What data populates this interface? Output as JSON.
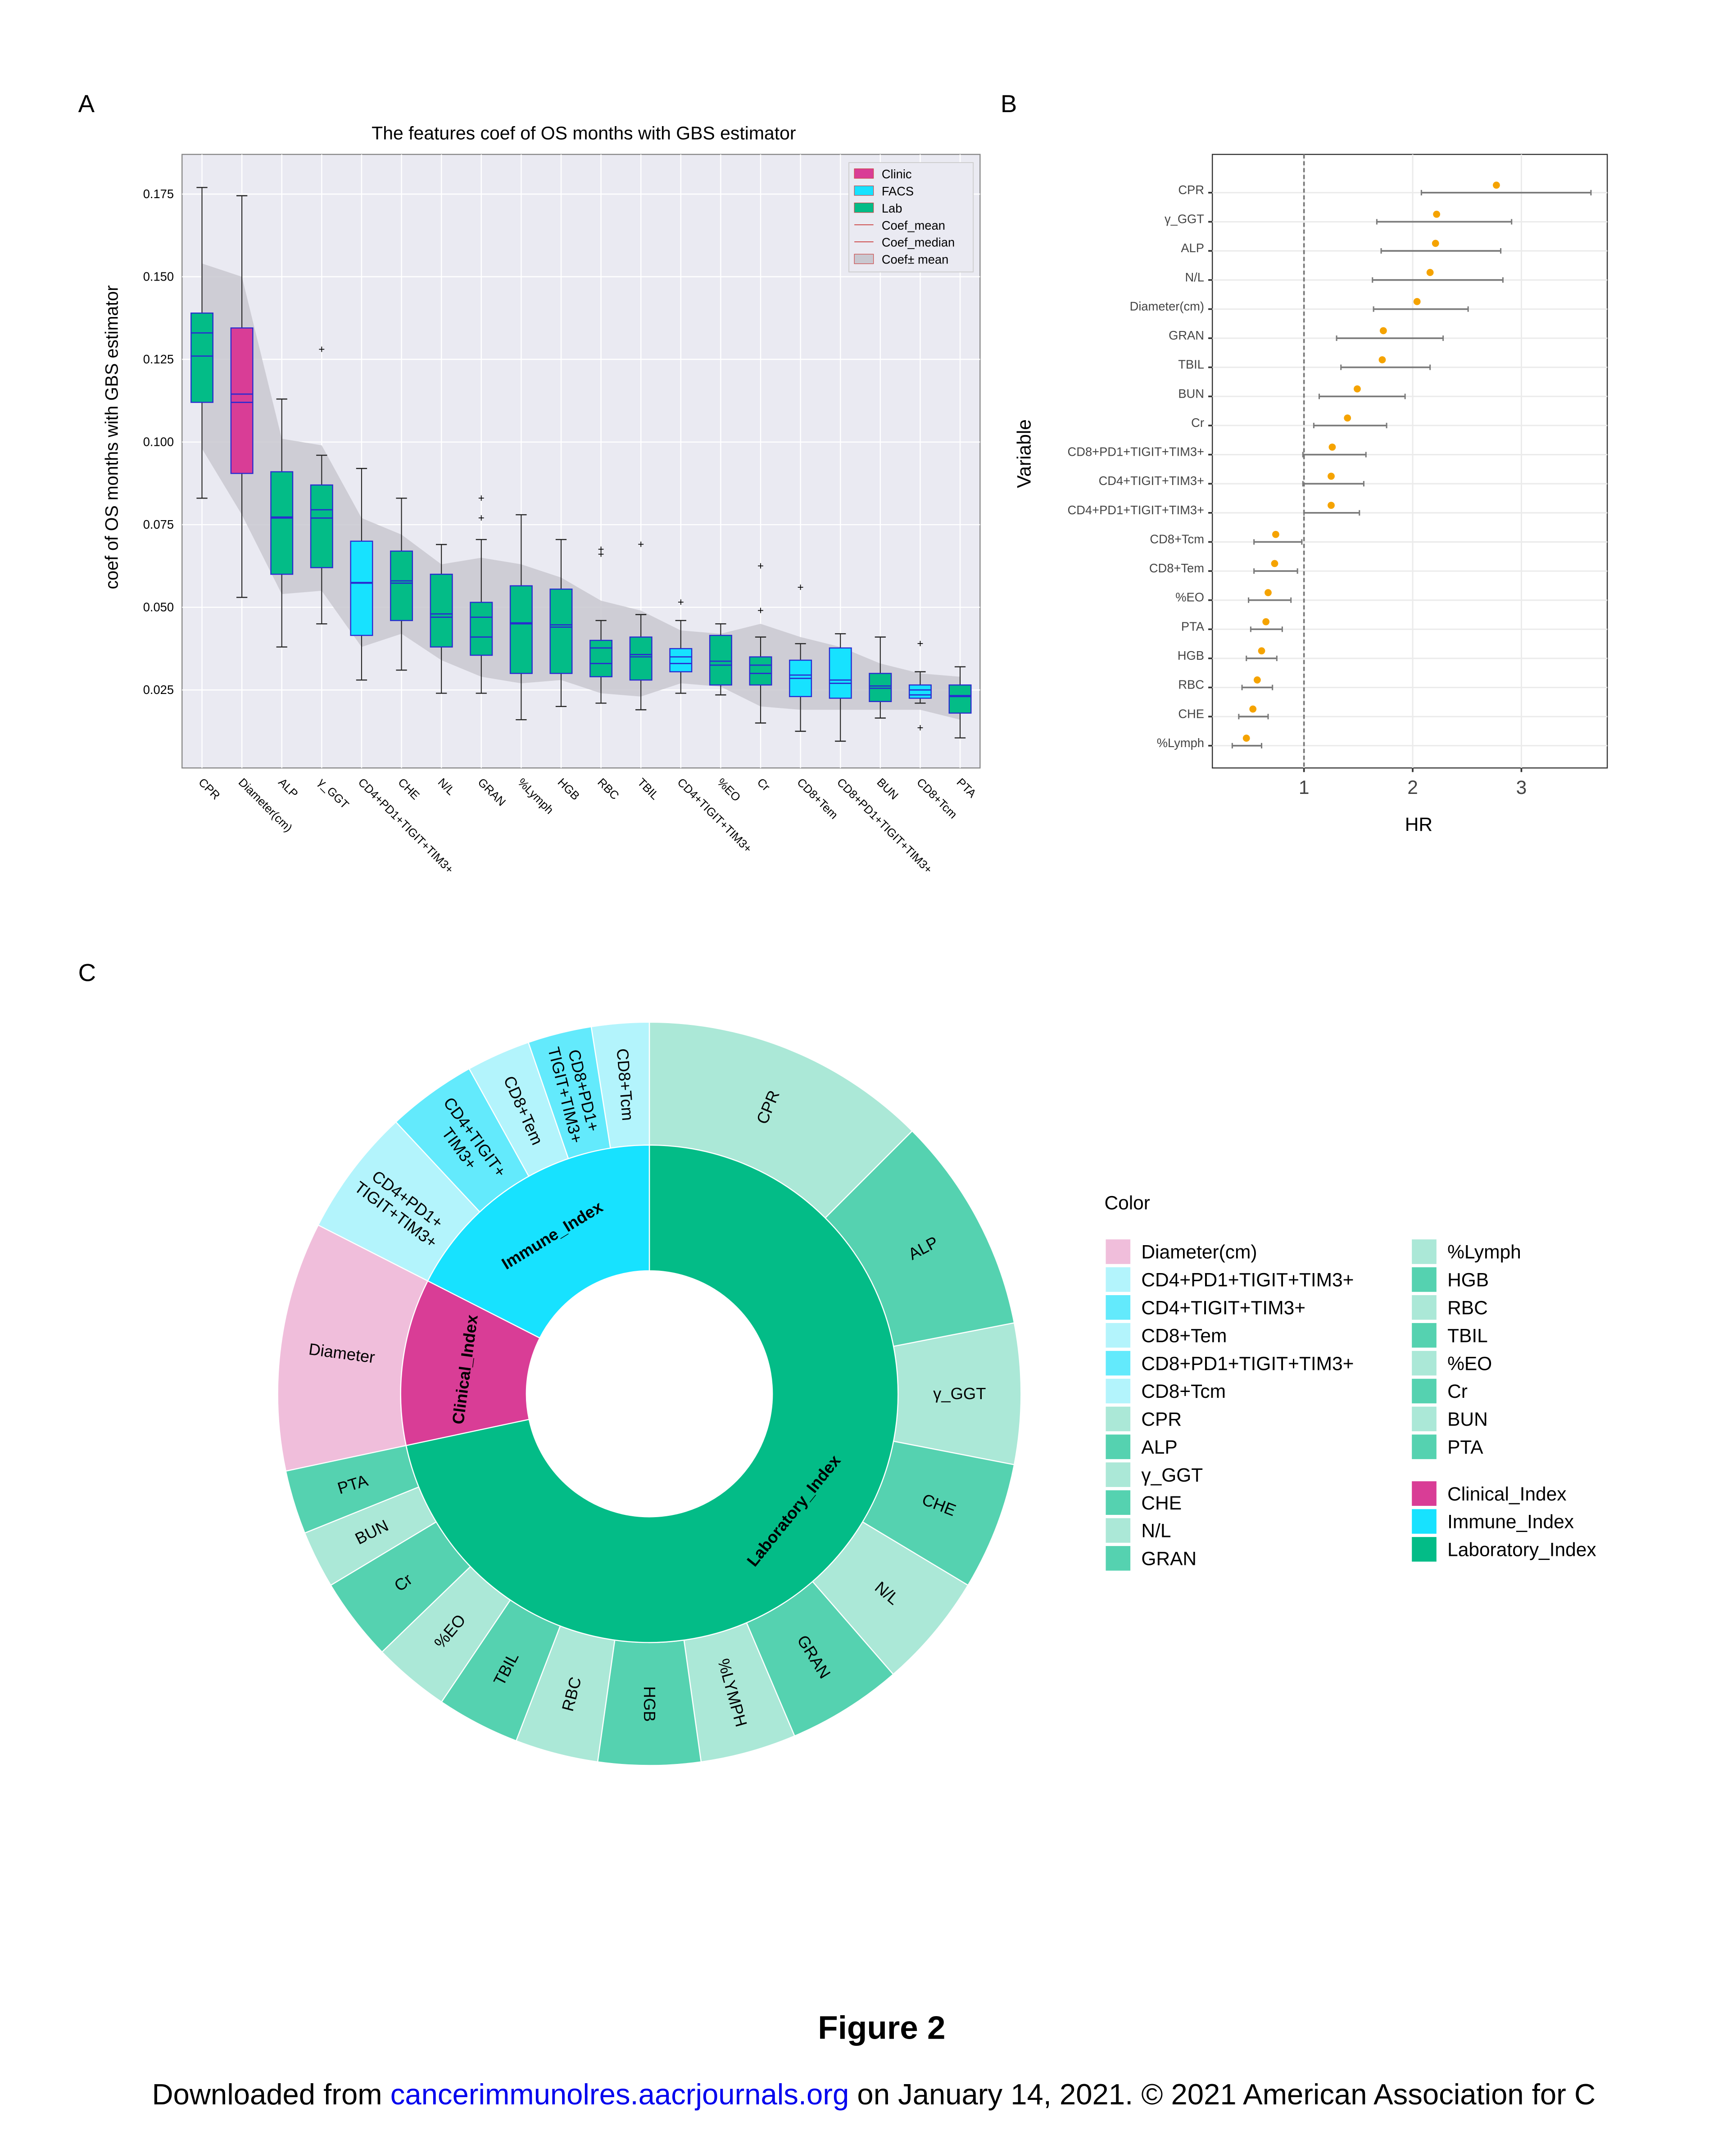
{
  "panels": {
    "a": "A",
    "b": "B",
    "c": "C"
  },
  "figure_caption": "Figure 2",
  "footer": {
    "prefix": "Downloaded from ",
    "link": "cancerimmunolres.aacrjournals.org",
    "suffix": " on January 14, 2021. © 2021 American Association for C",
    "link_color": "#0000ee"
  },
  "colors": {
    "clinic": "#d93d96",
    "facs": "#17e2ff",
    "lab": "#03bc87",
    "plot_bg": "#eaeaf2",
    "band": "#c9c8d0",
    "hr_point": "#f5a300",
    "hr_bar": "#7a7a7a"
  },
  "chart_data": [
    {
      "type": "box",
      "title": "The features coef of OS months with GBS estimator",
      "xlabel": "",
      "ylabel": "coef of OS months with GBS estimator",
      "ylim": [
        0.0014,
        0.187
      ],
      "yticks": [
        "0.025",
        "0.050",
        "0.075",
        "0.100",
        "0.125",
        "0.150",
        "0.175"
      ],
      "grid": true,
      "legend": {
        "position": "top-right",
        "entries": [
          "Clinic",
          "FACS",
          "Lab",
          "Coef_mean",
          "Coef_median",
          "Coef± mean"
        ]
      },
      "categories": [
        "CPR",
        "Diameter(cm)",
        "ALP",
        "γ_GGT",
        "CD4+PD1+TIGIT+TIM3+",
        "CHE",
        "N/L",
        "GRAN",
        "%Lymph",
        "HGB",
        "RBC",
        "TBIL",
        "CD4+TIGIT+TIM3+",
        "%EO",
        "Cr",
        "CD8+Tem",
        "CD8+PD1+TIGIT+TIM3+",
        "BUN",
        "CD8+Tcm",
        "PTA"
      ],
      "groups": [
        "Lab",
        "Clinic",
        "Lab",
        "Lab",
        "FACS",
        "Lab",
        "Lab",
        "Lab",
        "Lab",
        "Lab",
        "Lab",
        "Lab",
        "FACS",
        "Lab",
        "Lab",
        "FACS",
        "FACS",
        "Lab",
        "FACS",
        "Lab"
      ],
      "boxes": [
        {
          "min": 0.083,
          "q1": 0.112,
          "median": 0.126,
          "mean": 0.133,
          "q3": 0.139,
          "max": 0.177,
          "outliers": []
        },
        {
          "min": 0.053,
          "q1": 0.0905,
          "median": 0.112,
          "mean": 0.1145,
          "q3": 0.1345,
          "max": 0.1745,
          "outliers": []
        },
        {
          "min": 0.038,
          "q1": 0.06,
          "median": 0.077,
          "mean": 0.0773,
          "q3": 0.091,
          "max": 0.113,
          "outliers": []
        },
        {
          "min": 0.045,
          "q1": 0.062,
          "median": 0.077,
          "mean": 0.0795,
          "q3": 0.087,
          "max": 0.096,
          "outliers": [
            0.128
          ]
        },
        {
          "min": 0.028,
          "q1": 0.0415,
          "median": 0.0573,
          "mean": 0.0575,
          "q3": 0.07,
          "max": 0.092,
          "outliers": []
        },
        {
          "min": 0.031,
          "q1": 0.046,
          "median": 0.0573,
          "mean": 0.058,
          "q3": 0.067,
          "max": 0.083,
          "outliers": []
        },
        {
          "min": 0.024,
          "q1": 0.038,
          "median": 0.047,
          "mean": 0.048,
          "q3": 0.06,
          "max": 0.069,
          "outliers": []
        },
        {
          "min": 0.024,
          "q1": 0.0355,
          "median": 0.041,
          "mean": 0.047,
          "q3": 0.0515,
          "max": 0.0705,
          "outliers": [
            0.077,
            0.083
          ]
        },
        {
          "min": 0.016,
          "q1": 0.03,
          "median": 0.045,
          "mean": 0.0453,
          "q3": 0.0565,
          "max": 0.078,
          "outliers": []
        },
        {
          "min": 0.02,
          "q1": 0.03,
          "median": 0.044,
          "mean": 0.0447,
          "q3": 0.0555,
          "max": 0.0705,
          "outliers": []
        },
        {
          "min": 0.021,
          "q1": 0.029,
          "median": 0.033,
          "mean": 0.0377,
          "q3": 0.04,
          "max": 0.046,
          "outliers": [
            0.066,
            0.0675
          ]
        },
        {
          "min": 0.019,
          "q1": 0.028,
          "median": 0.035,
          "mean": 0.0357,
          "q3": 0.041,
          "max": 0.0478,
          "outliers": [
            0.069
          ]
        },
        {
          "min": 0.024,
          "q1": 0.0305,
          "median": 0.033,
          "mean": 0.035,
          "q3": 0.0375,
          "max": 0.046,
          "outliers": [
            0.0515
          ]
        },
        {
          "min": 0.0235,
          "q1": 0.0265,
          "median": 0.0325,
          "mean": 0.0337,
          "q3": 0.0415,
          "max": 0.045,
          "outliers": []
        },
        {
          "min": 0.015,
          "q1": 0.0265,
          "median": 0.03,
          "mean": 0.0325,
          "q3": 0.035,
          "max": 0.041,
          "outliers": [
            0.049,
            0.0625
          ]
        },
        {
          "min": 0.0125,
          "q1": 0.023,
          "median": 0.0285,
          "mean": 0.0295,
          "q3": 0.034,
          "max": 0.039,
          "outliers": [
            0.056
          ]
        },
        {
          "min": 0.0095,
          "q1": 0.0225,
          "median": 0.027,
          "mean": 0.028,
          "q3": 0.0377,
          "max": 0.042,
          "outliers": []
        },
        {
          "min": 0.0165,
          "q1": 0.0215,
          "median": 0.0255,
          "mean": 0.0262,
          "q3": 0.03,
          "max": 0.041,
          "outliers": []
        },
        {
          "min": 0.021,
          "q1": 0.0225,
          "median": 0.0235,
          "mean": 0.025,
          "q3": 0.0265,
          "max": 0.0305,
          "outliers": [
            0.039,
            0.0135
          ]
        },
        {
          "min": 0.0105,
          "q1": 0.018,
          "median": 0.023,
          "mean": 0.0233,
          "q3": 0.0265,
          "max": 0.032,
          "outliers": []
        }
      ],
      "band_upper": [
        0.154,
        0.15,
        0.101,
        0.099,
        0.077,
        0.072,
        0.063,
        0.065,
        0.063,
        0.059,
        0.052,
        0.049,
        0.043,
        0.042,
        0.045,
        0.041,
        0.038,
        0.033,
        0.03,
        0.029
      ],
      "band_lower": [
        0.098,
        0.078,
        0.054,
        0.055,
        0.038,
        0.042,
        0.034,
        0.029,
        0.027,
        0.028,
        0.024,
        0.023,
        0.027,
        0.026,
        0.02,
        0.019,
        0.019,
        0.019,
        0.019,
        0.016
      ]
    },
    {
      "type": "forest",
      "xlabel": "HR",
      "ylabel": "Variable",
      "xlim": [
        0.157,
        3.79
      ],
      "xticks": [
        "1",
        "2",
        "3"
      ],
      "reference_line": 1,
      "grid": true,
      "rows": [
        {
          "label": "CPR",
          "hr": 2.77,
          "lo": 2.08,
          "hi": 3.64
        },
        {
          "label": "γ_GGT",
          "hr": 2.22,
          "lo": 1.67,
          "hi": 2.91
        },
        {
          "label": "ALP",
          "hr": 2.21,
          "lo": 1.71,
          "hi": 2.81
        },
        {
          "label": "N/L",
          "hr": 2.16,
          "lo": 1.63,
          "hi": 2.83
        },
        {
          "label": "Diameter(cm)",
          "hr": 2.04,
          "lo": 1.64,
          "hi": 2.51
        },
        {
          "label": "GRAN",
          "hr": 1.73,
          "lo": 1.3,
          "hi": 2.28
        },
        {
          "label": "TBIL",
          "hr": 1.72,
          "lo": 1.34,
          "hi": 2.16
        },
        {
          "label": "BUN",
          "hr": 1.49,
          "lo": 1.14,
          "hi": 1.93
        },
        {
          "label": "Cr",
          "hr": 1.4,
          "lo": 1.09,
          "hi": 1.76
        },
        {
          "label": "CD8+PD1+TIGIT+TIM3+",
          "hr": 1.26,
          "lo": 0.99,
          "hi": 1.57
        },
        {
          "label": "CD4+TIGIT+TIM3+",
          "hr": 1.25,
          "lo": 0.99,
          "hi": 1.55
        },
        {
          "label": "CD4+PD1+TIGIT+TIM3+",
          "hr": 1.25,
          "lo": 1.0,
          "hi": 1.51
        },
        {
          "label": "CD8+Tcm",
          "hr": 0.74,
          "lo": 0.54,
          "hi": 0.98
        },
        {
          "label": "CD8+Tem",
          "hr": 0.73,
          "lo": 0.54,
          "hi": 0.94
        },
        {
          "label": "%EO",
          "hr": 0.67,
          "lo": 0.49,
          "hi": 0.88
        },
        {
          "label": "PTA",
          "hr": 0.65,
          "lo": 0.51,
          "hi": 0.8
        },
        {
          "label": "HGB",
          "hr": 0.61,
          "lo": 0.47,
          "hi": 0.75
        },
        {
          "label": "RBC",
          "hr": 0.57,
          "lo": 0.43,
          "hi": 0.71
        },
        {
          "label": "CHE",
          "hr": 0.53,
          "lo": 0.4,
          "hi": 0.67
        },
        {
          "label": "%Lymph",
          "hr": 0.47,
          "lo": 0.34,
          "hi": 0.61
        }
      ]
    },
    {
      "type": "sunburst",
      "legend_title": "Color",
      "inner": [
        {
          "label": "Laboratory_Index",
          "value": 258,
          "color": "#03bc87"
        },
        {
          "label": "Clinical_Index",
          "value": 39,
          "color": "#d93d96"
        },
        {
          "label": "Immune_Index",
          "value": 63,
          "color": "#17e2ff"
        }
      ],
      "outer": [
        {
          "label": "CPR",
          "value": 45,
          "color": "#abe8d7",
          "parent": "Laboratory_Index"
        },
        {
          "label": "ALP",
          "value": 34,
          "color": "#55d2b0",
          "parent": "Laboratory_Index"
        },
        {
          "label": "γ_GGT",
          "value": 22,
          "color": "#abe8d7",
          "parent": "Laboratory_Index"
        },
        {
          "label": "CHE",
          "value": 20,
          "color": "#55d2b0",
          "parent": "Laboratory_Index"
        },
        {
          "label": "N/L",
          "value": 18,
          "color": "#abe8d7",
          "parent": "Laboratory_Index"
        },
        {
          "label": "GRAN",
          "value": 18,
          "color": "#55d2b0",
          "parent": "Laboratory_Index"
        },
        {
          "label": "%LYMPH",
          "value": 15,
          "color": "#abe8d7",
          "parent": "Laboratory_Index"
        },
        {
          "label": "HGB",
          "value": 16,
          "color": "#55d2b0",
          "parent": "Laboratory_Index"
        },
        {
          "label": "RBC",
          "value": 13,
          "color": "#abe8d7",
          "parent": "Laboratory_Index"
        },
        {
          "label": "TBIL",
          "value": 13,
          "color": "#55d2b0",
          "parent": "Laboratory_Index"
        },
        {
          "label": "%EO",
          "value": 12,
          "color": "#abe8d7",
          "parent": "Laboratory_Index"
        },
        {
          "label": "Cr",
          "value": 13,
          "color": "#55d2b0",
          "parent": "Laboratory_Index"
        },
        {
          "label": "BUN",
          "value": 9,
          "color": "#abe8d7",
          "parent": "Laboratory_Index"
        },
        {
          "label": "PTA",
          "value": 10,
          "color": "#55d2b0",
          "parent": "Laboratory_Index"
        },
        {
          "label": "Diameter",
          "value": 39,
          "color": "#f0bedb",
          "parent": "Clinical_Index"
        },
        {
          "label": "CD4+PD1+ TIGIT+TIM3+",
          "value": 20,
          "color": "#b3f4fc",
          "parent": "Immune_Index"
        },
        {
          "label": "CD4+TIGIT+ TIM3+",
          "value": 14,
          "color": "#63eafc",
          "parent": "Immune_Index"
        },
        {
          "label": "CD8+Tem",
          "value": 10,
          "color": "#b3f4fc",
          "parent": "Immune_Index"
        },
        {
          "label": "CD8+PD1+ TIGIT+TIM3+",
          "value": 10,
          "color": "#63eafc",
          "parent": "Immune_Index"
        },
        {
          "label": "CD8+Tcm",
          "value": 9,
          "color": "#b3f4fc",
          "parent": "Immune_Index"
        }
      ],
      "legend_col1": [
        {
          "label": "Diameter(cm)",
          "color": "#f0bedb"
        },
        {
          "label": "CD4+PD1+TIGIT+TIM3+",
          "color": "#b3f4fc"
        },
        {
          "label": "CD4+TIGIT+TIM3+",
          "color": "#63eafc"
        },
        {
          "label": "CD8+Tem",
          "color": "#b3f4fc"
        },
        {
          "label": "CD8+PD1+TIGIT+TIM3+",
          "color": "#63eafc"
        },
        {
          "label": "CD8+Tcm",
          "color": "#b3f4fc"
        },
        {
          "label": "CPR",
          "color": "#abe8d7"
        },
        {
          "label": "ALP",
          "color": "#55d2b0"
        },
        {
          "label": "γ_GGT",
          "color": "#abe8d7"
        },
        {
          "label": "CHE",
          "color": "#55d2b0"
        },
        {
          "label": "N/L",
          "color": "#abe8d7"
        },
        {
          "label": "GRAN",
          "color": "#55d2b0"
        }
      ],
      "legend_col2": [
        {
          "label": "%Lymph",
          "color": "#abe8d7"
        },
        {
          "label": "HGB",
          "color": "#55d2b0"
        },
        {
          "label": "RBC",
          "color": "#abe8d7"
        },
        {
          "label": "TBIL",
          "color": "#55d2b0"
        },
        {
          "label": "%EO",
          "color": "#abe8d7"
        },
        {
          "label": "Cr",
          "color": "#55d2b0"
        },
        {
          "label": "BUN",
          "color": "#abe8d7"
        },
        {
          "label": "PTA",
          "color": "#55d2b0"
        }
      ],
      "legend_col2_index": [
        {
          "label": "Clinical_Index",
          "color": "#d93d96"
        },
        {
          "label": "Immune_Index",
          "color": "#17e2ff"
        },
        {
          "label": "Laboratory_Index",
          "color": "#03bc87"
        }
      ]
    }
  ]
}
